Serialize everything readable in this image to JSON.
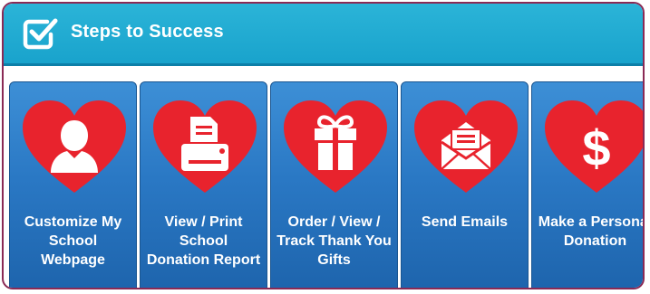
{
  "header": {
    "title": "Steps to Success",
    "icon": "checkbox-icon"
  },
  "colors": {
    "header": "#19a3cc",
    "tile": "#2a78c4",
    "heart": "#e8232d",
    "border": "#8a2a55"
  },
  "tiles": [
    {
      "label": "Customize My School Webpage",
      "icon": "person-icon"
    },
    {
      "label": "View / Print School Donation Report",
      "icon": "printer-icon"
    },
    {
      "label": "Order / View / Track Thank You Gifts",
      "icon": "gift-icon"
    },
    {
      "label": "Send Emails",
      "icon": "envelope-icon"
    },
    {
      "label": "Make a Personal Donation",
      "icon": "dollar-icon"
    }
  ]
}
